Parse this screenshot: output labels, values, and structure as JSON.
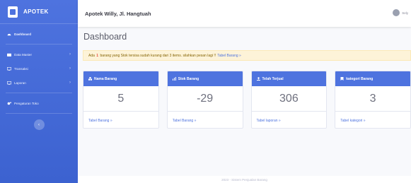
{
  "brand": {
    "name": "APOTEK"
  },
  "sidebar": {
    "items": [
      {
        "label": "Dashboard"
      },
      {
        "label": "Data Master",
        "chevron": "›"
      },
      {
        "label": "Transaksi",
        "chevron": "›"
      },
      {
        "label": "Laporan",
        "chevron": "›"
      },
      {
        "label": "Pengaturan Toko"
      }
    ],
    "toggle_glyph": "‹"
  },
  "topbar": {
    "title": "Apotek Willy, Jl. Hangtuah",
    "user_name": "Sely"
  },
  "page": {
    "title": "Dashboard"
  },
  "alert": {
    "prefix": "Ada",
    "count": "1",
    "message": "barang yang Stok tersisa sudah kurang dari 3 items. silahkan pesan lagi !!",
    "link": "Tabel Barang »"
  },
  "cards": [
    {
      "title": "Nama Barang",
      "value": "5",
      "link": "Tabel Barang »"
    },
    {
      "title": "Stok Barang",
      "value": "-29",
      "link": "Tabel Barang »"
    },
    {
      "title": "Telah Terjual",
      "value": "306",
      "link": "Tabel laporan »"
    },
    {
      "title": "kategori Barang",
      "value": "3",
      "link": "Tabel kategori »"
    }
  ],
  "footer": {
    "text": "2023 - Sistem Penjualan Barang"
  },
  "colors": {
    "primary": "#4e73df",
    "alert_bg": "#fdf3d8",
    "alert_count": "#e74a3b"
  }
}
